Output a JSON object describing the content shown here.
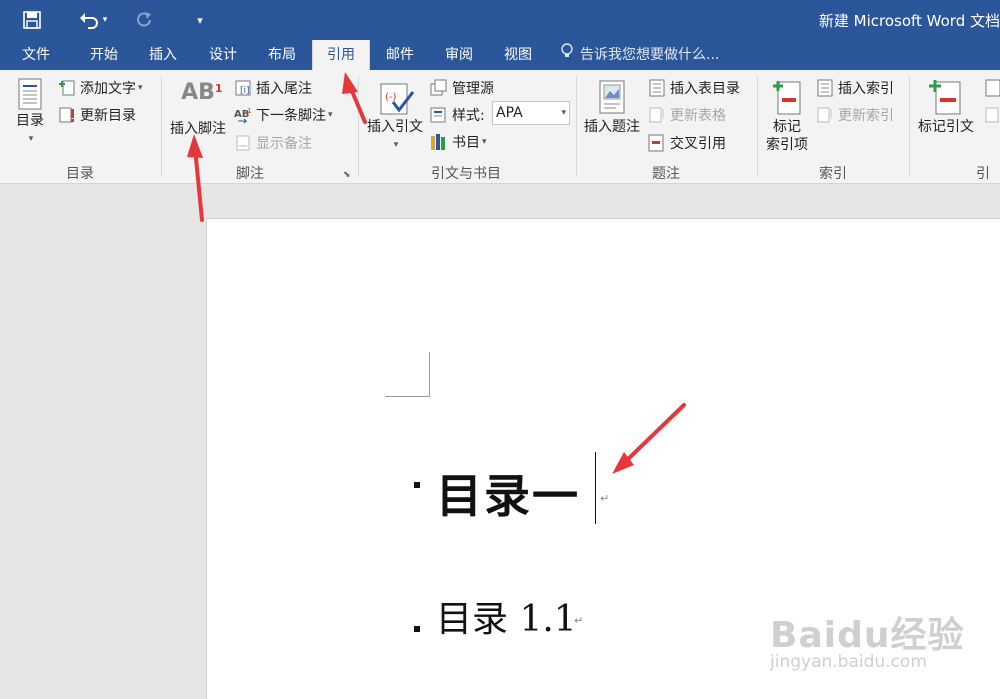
{
  "window": {
    "title": "新建 Microsoft Word 文档"
  },
  "quick_access": {
    "save": "save-icon",
    "undo": "undo-icon",
    "redo": "redo-icon",
    "customize": "customize-qat-icon"
  },
  "tabs": [
    {
      "label": "文件"
    },
    {
      "label": "开始"
    },
    {
      "label": "插入"
    },
    {
      "label": "设计"
    },
    {
      "label": "布局"
    },
    {
      "label": "引用"
    },
    {
      "label": "邮件"
    },
    {
      "label": "审阅"
    },
    {
      "label": "视图"
    }
  ],
  "active_tab": "引用",
  "tell_me": {
    "placeholder": "告诉我您想要做什么..."
  },
  "ribbon": {
    "toc": {
      "group_label": "目录",
      "toc_button": "目录",
      "add_text": "添加文字",
      "update_table": "更新目录"
    },
    "footnotes": {
      "group_label": "脚注",
      "insert_footnote": "插入脚注",
      "insert_endnote": "插入尾注",
      "next_footnote": "下一条脚注",
      "show_notes": "显示备注"
    },
    "citations": {
      "group_label": "引文与书目",
      "insert_citation": "插入引文",
      "manage_sources": "管理源",
      "style_label": "样式:",
      "style_value": "APA",
      "bibliography": "书目"
    },
    "captions": {
      "group_label": "题注",
      "insert_caption": "插入题注",
      "insert_table_of_figures": "插入表目录",
      "update_table": "更新表格",
      "cross_reference": "交叉引用"
    },
    "index": {
      "group_label": "索引",
      "mark_entry_line1": "标记",
      "mark_entry_line2": "索引项",
      "insert_index": "插入索引",
      "update_index": "更新索引"
    },
    "toa": {
      "group_label": "引",
      "mark_citation": "标记引文"
    }
  },
  "document": {
    "heading1": "目录一",
    "heading2": "目录 1.1",
    "para_mark": "↵"
  },
  "watermark": {
    "logo": "Baidu经验",
    "url": "jingyan.baidu.com"
  },
  "colors": {
    "accent": "#2b579a",
    "arrow": "#e8373a",
    "ribbon_bg": "#f3f3f3"
  }
}
